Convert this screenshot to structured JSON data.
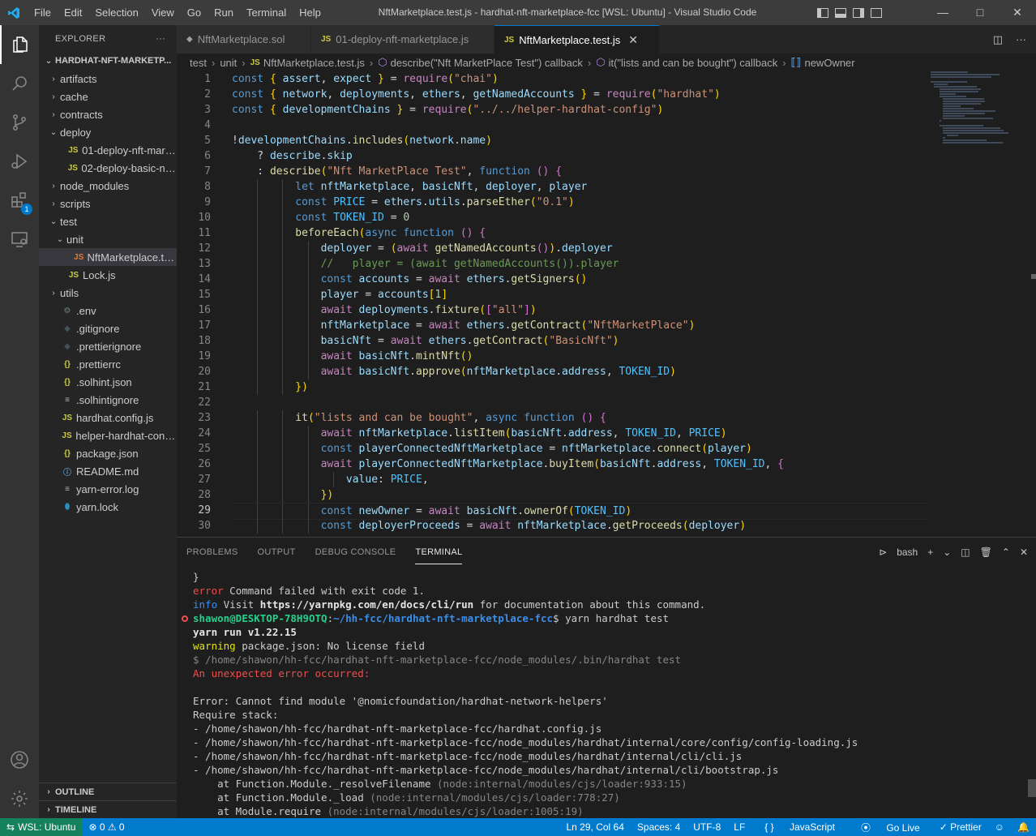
{
  "titlebar": {
    "menu": [
      "File",
      "Edit",
      "Selection",
      "View",
      "Go",
      "Run",
      "Terminal",
      "Help"
    ],
    "title": "NftMarketplace.test.js - hardhat-nft-marketplace-fcc [WSL: Ubuntu] - Visual Studio Code"
  },
  "activity": {
    "extensions_badge": "1"
  },
  "sidebar": {
    "header": "EXPLORER",
    "more": "···",
    "root": "HARDHAT-NFT-MARKETP...",
    "items": [
      {
        "label": "artifacts",
        "twisty": "›",
        "icon": ""
      },
      {
        "label": "cache",
        "twisty": "›",
        "icon": ""
      },
      {
        "label": "contracts",
        "twisty": "›",
        "icon": ""
      },
      {
        "label": "deploy",
        "twisty": "⌄",
        "icon": ""
      },
      {
        "label": "01-deploy-nft-mark...",
        "twisty": "",
        "icon": "JS"
      },
      {
        "label": "02-deploy-basic-nft.js",
        "twisty": "",
        "icon": "JS"
      },
      {
        "label": "node_modules",
        "twisty": "›",
        "icon": ""
      },
      {
        "label": "scripts",
        "twisty": "›",
        "icon": ""
      },
      {
        "label": "test",
        "twisty": "⌄",
        "icon": ""
      },
      {
        "label": "unit",
        "twisty": "⌄",
        "icon": ""
      },
      {
        "label": "NftMarketplace.tes...",
        "twisty": "",
        "icon": "JS"
      },
      {
        "label": "Lock.js",
        "twisty": "",
        "icon": "JS"
      },
      {
        "label": "utils",
        "twisty": "›",
        "icon": ""
      },
      {
        "label": ".env",
        "twisty": "",
        "icon": "⚙"
      },
      {
        "label": ".gitignore",
        "twisty": "",
        "icon": "◆"
      },
      {
        "label": ".prettierignore",
        "twisty": "",
        "icon": "◆"
      },
      {
        "label": ".prettierrc",
        "twisty": "",
        "icon": "{}"
      },
      {
        "label": ".solhint.json",
        "twisty": "",
        "icon": "{}"
      },
      {
        "label": ".solhintignore",
        "twisty": "",
        "icon": "≡"
      },
      {
        "label": "hardhat.config.js",
        "twisty": "",
        "icon": "JS"
      },
      {
        "label": "helper-hardhat-confi...",
        "twisty": "",
        "icon": "JS"
      },
      {
        "label": "package.json",
        "twisty": "",
        "icon": "{}"
      },
      {
        "label": "README.md",
        "twisty": "",
        "icon": "ⓘ"
      },
      {
        "label": "yarn-error.log",
        "twisty": "",
        "icon": "≡"
      },
      {
        "label": "yarn.lock",
        "twisty": "",
        "icon": "⬮"
      }
    ],
    "outline": "OUTLINE",
    "timeline": "TIMELINE"
  },
  "tabs": [
    {
      "label": "NftMarketplace.sol",
      "icon": "◆"
    },
    {
      "label": "01-deploy-nft-marketplace.js",
      "icon": "JS"
    },
    {
      "label": "NftMarketplace.test.js",
      "icon": "JS",
      "close": "✕"
    }
  ],
  "breadcrumb": {
    "parts": [
      "test",
      "unit",
      "NftMarketplace.test.js",
      "describe(\"Nft MarketPlace Test\") callback",
      "it(\"lists and can be bought\") callback",
      "newOwner"
    ],
    "js_icon": "JS",
    "symbol_icon": "⬡",
    "var_icon": "⟦⟧"
  },
  "editor": {
    "line_numbers": [
      "1",
      "2",
      "3",
      "4",
      "5",
      "6",
      "7",
      "8",
      "9",
      "10",
      "11",
      "12",
      "13",
      "14",
      "15",
      "16",
      "17",
      "18",
      "19",
      "20",
      "21",
      "22",
      "23",
      "24",
      "25",
      "26",
      "27",
      "28",
      "29",
      "30"
    ],
    "current_line": 29,
    "lines": [
      "const { assert, expect } = require(\"chai\")",
      "const { network, deployments, ethers, getNamedAccounts } = require(\"hardhat\")",
      "const { developmentChains } = require(\"../../helper-hardhat-config\")",
      "",
      "!developmentChains.includes(network.name)",
      "    ? describe.skip",
      "    : describe(\"Nft MarketPlace Test\", function () {",
      "          let nftMarketplace, basicNft, deployer, player",
      "          const PRICE = ethers.utils.parseEther(\"0.1\")",
      "          const TOKEN_ID = 0",
      "          beforeEach(async function () {",
      "              deployer = (await getNamedAccounts()).deployer",
      "              //   player = (await getNamedAccounts()).player",
      "              const accounts = await ethers.getSigners()",
      "              player = accounts[1]",
      "              await deployments.fixture([\"all\"])",
      "              nftMarketplace = await ethers.getContract(\"NftMarketPlace\")",
      "              basicNft = await ethers.getContract(\"BasicNft\")",
      "              await basicNft.mintNft()",
      "              await basicNft.approve(nftMarketplace.address, TOKEN_ID)",
      "          })",
      "",
      "          it(\"lists and can be bought\", async function () {",
      "              await nftMarketplace.listItem(basicNft.address, TOKEN_ID, PRICE)",
      "              const playerConnectedNftMarketplace = nftMarketplace.connect(player)",
      "              await playerConnectedNftMarketplace.buyItem(basicNft.address, TOKEN_ID, {",
      "                  value: PRICE,",
      "              })",
      "              const newOwner = await basicNft.ownerOf(TOKEN_ID)",
      "              const deployerProceeds = await nftMarketplace.getProceeds(deployer)"
    ]
  },
  "panel": {
    "tabs": [
      "PROBLEMS",
      "OUTPUT",
      "DEBUG CONSOLE",
      "TERMINAL"
    ],
    "active_tab": "TERMINAL",
    "shell": "bash",
    "terminal": {
      "l1": "}",
      "l2_a": "error",
      "l2_b": " Command failed with exit code 1.",
      "l3_a": "info",
      "l3_b": " Visit ",
      "l3_c": "https://yarnpkg.com/en/docs/cli/run",
      "l3_d": " for documentation about this command.",
      "l4_user": "shawon@DESKTOP-78H9OTQ",
      "l4_colon": ":",
      "l4_path": "~/hh-fcc/hardhat-nft-marketplace-fcc",
      "l4_cmd": "$ yarn hardhat test",
      "l5": "yarn run v1.22.15",
      "l6_a": "warning",
      "l6_b": " package.json: No license field",
      "l7": "$ /home/shawon/hh-fcc/hardhat-nft-marketplace-fcc/node_modules/.bin/hardhat test",
      "l8": "An unexpected error occurred:",
      "l9": "",
      "l10": "Error: Cannot find module '@nomicfoundation/hardhat-network-helpers'",
      "l11": "Require stack:",
      "l12": "- /home/shawon/hh-fcc/hardhat-nft-marketplace-fcc/hardhat.config.js",
      "l13": "- /home/shawon/hh-fcc/hardhat-nft-marketplace-fcc/node_modules/hardhat/internal/core/config/config-loading.js",
      "l14": "- /home/shawon/hh-fcc/hardhat-nft-marketplace-fcc/node_modules/hardhat/internal/cli/cli.js",
      "l15": "- /home/shawon/hh-fcc/hardhat-nft-marketplace-fcc/node_modules/hardhat/internal/cli/bootstrap.js",
      "l16_a": "    at Function.Module._resolveFilename ",
      "l16_b": "(node:internal/modules/cjs/loader:933:15)",
      "l17_a": "    at Function.Module._load ",
      "l17_b": "(node:internal/modules/cjs/loader:778:27)",
      "l18_a": "    at Module.require ",
      "l18_b": "(node:internal/modules/cjs/loader:1005:19)"
    }
  },
  "statusbar": {
    "remote": "WSL: Ubuntu",
    "problems": "⊗ 0 ⚠ 0",
    "position": "Ln 29, Col 64",
    "spaces": "Spaces: 4",
    "encoding": "UTF-8",
    "eol": "LF",
    "language": "JavaScript",
    "golive": "Go Live",
    "prettier": "✓ Prettier"
  },
  "colors": {
    "accent": "#007acc",
    "remote": "#16825d",
    "error_red": "#f14c4c"
  }
}
